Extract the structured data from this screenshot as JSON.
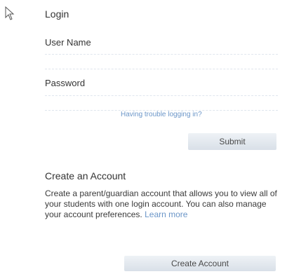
{
  "login": {
    "title": "Login",
    "username_label": "User Name",
    "username_value": "",
    "password_label": "Password",
    "password_value": "",
    "trouble_link": "Having trouble logging in?",
    "submit_label": "Submit"
  },
  "create_account": {
    "title": "Create an Account",
    "description": "Create a parent/guardian account that allows you to view all of your students with one login account. You can also manage your account preferences.",
    "learn_more": "Learn more",
    "button_label": "Create Account"
  }
}
